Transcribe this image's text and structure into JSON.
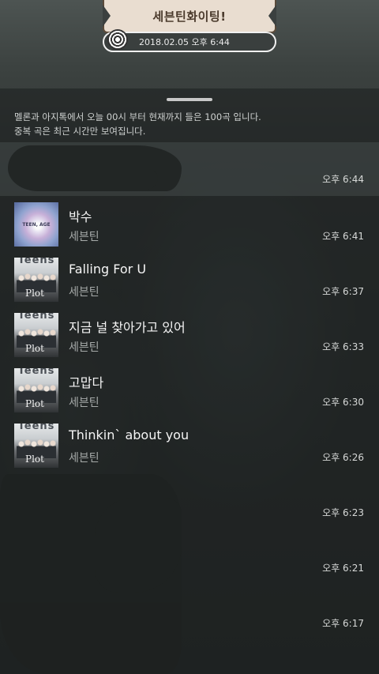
{
  "banner": {
    "title": "세븐틴화이팅!",
    "date": "2018.02.05 오후 6:44"
  },
  "notice": {
    "line1": "멜론과 아지톡에서 오늘 00시 부터 현재까지 들은 100곡 입니다.",
    "line2": "중복 곡은 최근 시간만 보여집니다."
  },
  "first_item": {
    "time": "오후 6:44"
  },
  "songs": [
    {
      "title": "박수",
      "artist": "세븐틴",
      "time": "오후 6:41",
      "album": "cosmic"
    },
    {
      "title": "Falling For U",
      "artist": "세븐틴",
      "time": "오후 6:37",
      "album": "plot"
    },
    {
      "title": "지금 널 찾아가고 있어",
      "artist": "세븐틴",
      "time": "오후 6:33",
      "album": "plot"
    },
    {
      "title": "고맙다",
      "artist": "세븐틴",
      "time": "오후 6:30",
      "album": "plot"
    },
    {
      "title": "Thinkin` about you",
      "artist": "세븐틴",
      "time": "오후 6:26",
      "album": "plot"
    }
  ],
  "album_art": {
    "plot_word": "Teens",
    "plot_label": "Plot",
    "cosmic_label": "TEEN, AGE"
  },
  "hidden_items": [
    {
      "time": "오후 6:23"
    },
    {
      "time": "오후 6:21"
    },
    {
      "time": "오후 6:17"
    }
  ],
  "colors": {
    "banner_bg": "#e9ddd0",
    "banner_text": "#4a3a2c",
    "panel_bg": "#252a29"
  }
}
